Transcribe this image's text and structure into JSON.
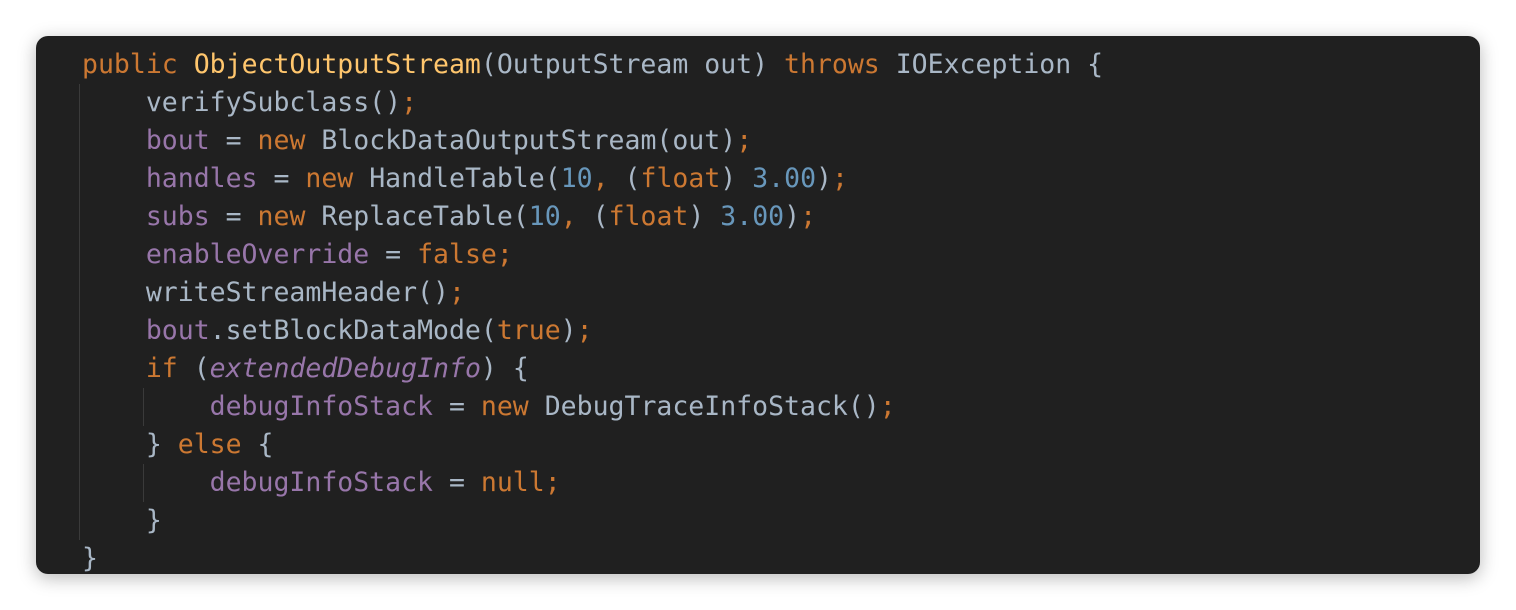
{
  "editor": {
    "theme_colors": {
      "background": "#202020",
      "keyword": "#cc7832",
      "method_decl": "#ffc66d",
      "field": "#9876aa",
      "number": "#6897bb",
      "plain": "#a9b7c6"
    },
    "lines": [
      {
        "tokens": [
          {
            "t": "public",
            "c": "kw"
          },
          {
            "t": " ",
            "c": "pl"
          },
          {
            "t": "ObjectOutputStream",
            "c": "fn"
          },
          {
            "t": "(OutputStream out) ",
            "c": "pl"
          },
          {
            "t": "throws",
            "c": "kw"
          },
          {
            "t": " IOException {",
            "c": "pl"
          }
        ]
      },
      {
        "tokens": [
          {
            "t": "    verifySubclass()",
            "c": "pl"
          },
          {
            "t": ";",
            "c": "kw"
          }
        ]
      },
      {
        "tokens": [
          {
            "t": "    ",
            "c": "pl"
          },
          {
            "t": "bout",
            "c": "fld"
          },
          {
            "t": " = ",
            "c": "pl"
          },
          {
            "t": "new",
            "c": "kw"
          },
          {
            "t": " BlockDataOutputStream(out)",
            "c": "pl"
          },
          {
            "t": ";",
            "c": "kw"
          }
        ]
      },
      {
        "tokens": [
          {
            "t": "    ",
            "c": "pl"
          },
          {
            "t": "handles",
            "c": "fld"
          },
          {
            "t": " = ",
            "c": "pl"
          },
          {
            "t": "new",
            "c": "kw"
          },
          {
            "t": " HandleTable(",
            "c": "pl"
          },
          {
            "t": "10",
            "c": "num"
          },
          {
            "t": ", ",
            "c": "kw"
          },
          {
            "t": "(",
            "c": "pl"
          },
          {
            "t": "float",
            "c": "kw"
          },
          {
            "t": ") ",
            "c": "pl"
          },
          {
            "t": "3.00",
            "c": "num"
          },
          {
            "t": ")",
            "c": "pl"
          },
          {
            "t": ";",
            "c": "kw"
          }
        ]
      },
      {
        "tokens": [
          {
            "t": "    ",
            "c": "pl"
          },
          {
            "t": "subs",
            "c": "fld"
          },
          {
            "t": " = ",
            "c": "pl"
          },
          {
            "t": "new",
            "c": "kw"
          },
          {
            "t": " ReplaceTable(",
            "c": "pl"
          },
          {
            "t": "10",
            "c": "num"
          },
          {
            "t": ", ",
            "c": "kw"
          },
          {
            "t": "(",
            "c": "pl"
          },
          {
            "t": "float",
            "c": "kw"
          },
          {
            "t": ") ",
            "c": "pl"
          },
          {
            "t": "3.00",
            "c": "num"
          },
          {
            "t": ")",
            "c": "pl"
          },
          {
            "t": ";",
            "c": "kw"
          }
        ]
      },
      {
        "tokens": [
          {
            "t": "    ",
            "c": "pl"
          },
          {
            "t": "enableOverride",
            "c": "fld"
          },
          {
            "t": " = ",
            "c": "pl"
          },
          {
            "t": "false",
            "c": "kw"
          },
          {
            "t": ";",
            "c": "kw"
          }
        ]
      },
      {
        "tokens": [
          {
            "t": "    writeStreamHeader()",
            "c": "pl"
          },
          {
            "t": ";",
            "c": "kw"
          }
        ]
      },
      {
        "tokens": [
          {
            "t": "    ",
            "c": "pl"
          },
          {
            "t": "bout",
            "c": "fld"
          },
          {
            "t": ".setBlockDataMode(",
            "c": "pl"
          },
          {
            "t": "true",
            "c": "kw"
          },
          {
            "t": ")",
            "c": "pl"
          },
          {
            "t": ";",
            "c": "kw"
          }
        ]
      },
      {
        "tokens": [
          {
            "t": "    ",
            "c": "pl"
          },
          {
            "t": "if",
            "c": "kw"
          },
          {
            "t": " (",
            "c": "pl"
          },
          {
            "t": "extendedDebugInfo",
            "c": "sfld"
          },
          {
            "t": ") {",
            "c": "pl"
          }
        ]
      },
      {
        "tokens": [
          {
            "t": "        ",
            "c": "pl"
          },
          {
            "t": "debugInfoStack",
            "c": "fld"
          },
          {
            "t": " = ",
            "c": "pl"
          },
          {
            "t": "new",
            "c": "kw"
          },
          {
            "t": " DebugTraceInfoStack()",
            "c": "pl"
          },
          {
            "t": ";",
            "c": "kw"
          }
        ]
      },
      {
        "tokens": [
          {
            "t": "    } ",
            "c": "pl"
          },
          {
            "t": "else",
            "c": "kw"
          },
          {
            "t": " {",
            "c": "pl"
          }
        ]
      },
      {
        "tokens": [
          {
            "t": "        ",
            "c": "pl"
          },
          {
            "t": "debugInfoStack",
            "c": "fld"
          },
          {
            "t": " = ",
            "c": "pl"
          },
          {
            "t": "null",
            "c": "kw"
          },
          {
            "t": ";",
            "c": "kw"
          }
        ]
      },
      {
        "tokens": [
          {
            "t": "    }",
            "c": "pl"
          }
        ]
      },
      {
        "tokens": [
          {
            "t": "}",
            "c": "pl"
          }
        ]
      }
    ]
  }
}
